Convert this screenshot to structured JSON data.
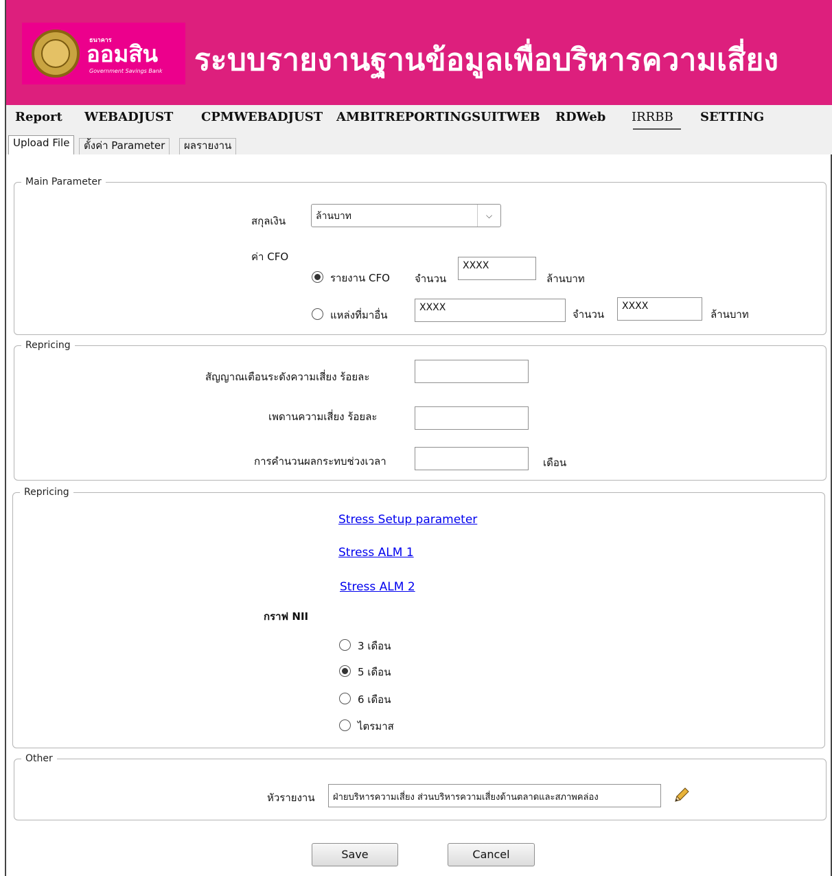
{
  "header": {
    "logo_top": "ธนาคาร",
    "logo_name": "ออมสิน",
    "logo_sub": "Government Savings Bank",
    "title": "ระบบรายงานฐานข้อมูลเพื่อบริหารความเสี่ยง"
  },
  "menu": {
    "items": [
      {
        "label": "Report"
      },
      {
        "label": "WEBADJUST"
      },
      {
        "label": "CPMWEBADJUST"
      },
      {
        "label": "AMBITREPORTINGSUITWEB"
      },
      {
        "label": "RDWeb"
      },
      {
        "label": "IRRBB"
      },
      {
        "label": "SETTING"
      }
    ]
  },
  "tabs": [
    {
      "label": "Upload File"
    },
    {
      "label": "ตั้งค่า Parameter"
    },
    {
      "label": "ผลรายงาน"
    }
  ],
  "main_parameter": {
    "legend": "Main Parameter",
    "currency_label": "สกุลเงิน",
    "currency_value": "ล้านบาท",
    "cfo_label": "ค่า CFO",
    "cfo_report_label": "รายงาน CFO",
    "amount_label": "จำนวน",
    "cfo_amount_value": "XXXX",
    "unit_label": "ล้านบาท",
    "other_source_label": "แหล่งที่มาอื่น",
    "other_source_value": "XXXX",
    "other_amount_value": "XXXX"
  },
  "repricing": {
    "legend": "Repricing",
    "warning_label": "สัญญาณเตือนระดังความเสี่ยง  ร้อยละ",
    "ceiling_label": "เพดานความเสี่ยง  ร้อยละ",
    "impact_label": "การคำนวนผลกระทบช่วงเวลา",
    "month_unit": "เดือน"
  },
  "stress": {
    "legend": "Repricing",
    "links": [
      {
        "label": "Stress Setup parameter"
      },
      {
        "label": "Stress ALM 1"
      },
      {
        "label": "Stress ALM 2"
      }
    ],
    "nii_label": "กราฟ NII",
    "options": [
      {
        "label": "3 เดือน",
        "checked": false
      },
      {
        "label": "5 เดือน",
        "checked": true
      },
      {
        "label": "6 เดือน",
        "checked": false
      },
      {
        "label": "ไตรมาส",
        "checked": false
      }
    ]
  },
  "other": {
    "legend": "Other",
    "report_head_label": "หัวรายงาน",
    "report_head_value": "ฝ่ายบริหารความเสี่ยง ส่วนบริหารความเสี่ยงด้านตลาดและสภาพคล่อง"
  },
  "buttons": {
    "save": "Save",
    "cancel": "Cancel"
  }
}
